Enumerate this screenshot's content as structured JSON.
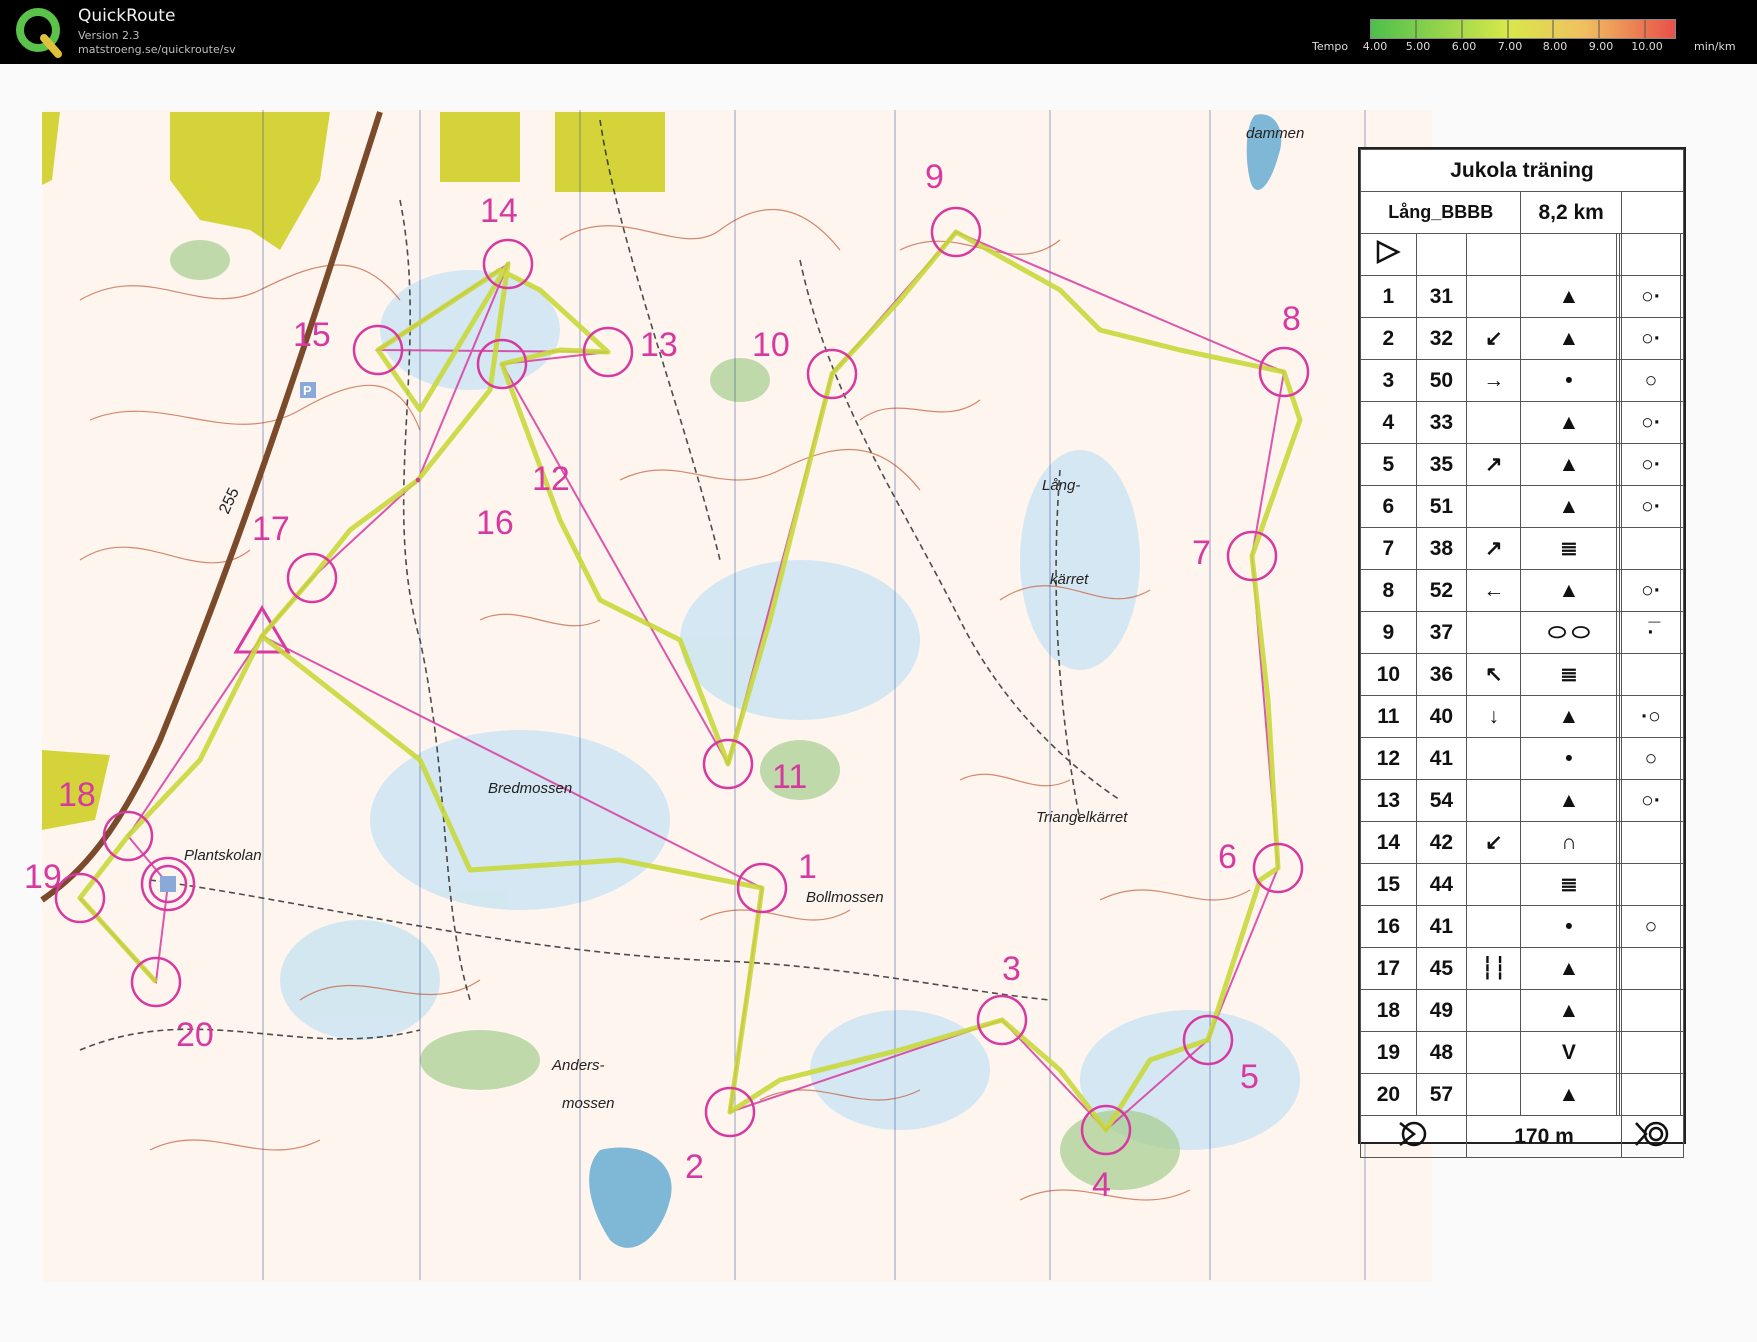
{
  "app": {
    "name": "QuickRoute",
    "version": "Version 2.3",
    "url": "matstroeng.se/quickroute/sv"
  },
  "tempo": {
    "label": "Tempo",
    "ticks": [
      "4.00",
      "5.00",
      "6.00",
      "7.00",
      "8.00",
      "9.00",
      "10.00"
    ],
    "unit": "min/km",
    "colors": {
      "fast": "#4dbf4d",
      "mid": "#e8e84a",
      "slow": "#e8504a"
    }
  },
  "map": {
    "place_names": [
      "dammen",
      "Lång-",
      "kärret",
      "Bredmossen",
      "Triangelkärret",
      "Plantskolan",
      "Bollmossen",
      "Anders-",
      "mossen"
    ],
    "road_number": "255",
    "parking_label": "P",
    "control_numbers": [
      "1",
      "2",
      "3",
      "4",
      "5",
      "6",
      "7",
      "8",
      "9",
      "10",
      "11",
      "12",
      "13",
      "14",
      "15",
      "16",
      "17",
      "18",
      "19",
      "20"
    ],
    "colors": {
      "course": "#d63aa0",
      "route": "#c8d83a",
      "contours": "#c25a35",
      "water": "#cfe6f2",
      "forest": "#9ac486",
      "urban": "#d4d43a"
    }
  },
  "description": {
    "title": "Jukola träning",
    "course_name": "Lång_BBBB",
    "length": "8,2 km",
    "finish_distance": "170 m",
    "controls": [
      {
        "num": "1",
        "code": "31",
        "dir": "",
        "feat": "▲",
        "detail": "○·"
      },
      {
        "num": "2",
        "code": "32",
        "dir": "↙",
        "feat": "▲",
        "detail": "○·"
      },
      {
        "num": "3",
        "code": "50",
        "dir": "→",
        "feat": "•",
        "detail": "○"
      },
      {
        "num": "4",
        "code": "33",
        "dir": "",
        "feat": "▲",
        "detail": "○·"
      },
      {
        "num": "5",
        "code": "35",
        "dir": "↗",
        "feat": "▲",
        "detail": "○·"
      },
      {
        "num": "6",
        "code": "51",
        "dir": "",
        "feat": "▲",
        "detail": "○·"
      },
      {
        "num": "7",
        "code": "38",
        "dir": "↗",
        "feat": "≣",
        "detail": ""
      },
      {
        "num": "8",
        "code": "52",
        "dir": "←",
        "feat": "▲",
        "detail": "○·"
      },
      {
        "num": "9",
        "code": "37",
        "dir": "",
        "feat": "⬭ ⬭",
        "detail": "·̅"
      },
      {
        "num": "10",
        "code": "36",
        "dir": "↖",
        "feat": "≣",
        "detail": ""
      },
      {
        "num": "11",
        "code": "40",
        "dir": "↓",
        "feat": "▲",
        "detail": "·○"
      },
      {
        "num": "12",
        "code": "41",
        "dir": "",
        "feat": "•",
        "detail": "○"
      },
      {
        "num": "13",
        "code": "54",
        "dir": "",
        "feat": "▲",
        "detail": "○·"
      },
      {
        "num": "14",
        "code": "42",
        "dir": "↙",
        "feat": "∩",
        "detail": ""
      },
      {
        "num": "15",
        "code": "44",
        "dir": "",
        "feat": "≣",
        "detail": ""
      },
      {
        "num": "16",
        "code": "41",
        "dir": "",
        "feat": "•",
        "detail": "○"
      },
      {
        "num": "17",
        "code": "45",
        "dir": "┆┆",
        "feat": "▲",
        "detail": ""
      },
      {
        "num": "18",
        "code": "49",
        "dir": "",
        "feat": "▲",
        "detail": ""
      },
      {
        "num": "19",
        "code": "48",
        "dir": "",
        "feat": "V",
        "detail": ""
      },
      {
        "num": "20",
        "code": "57",
        "dir": "",
        "feat": "▲",
        "detail": ""
      }
    ]
  }
}
